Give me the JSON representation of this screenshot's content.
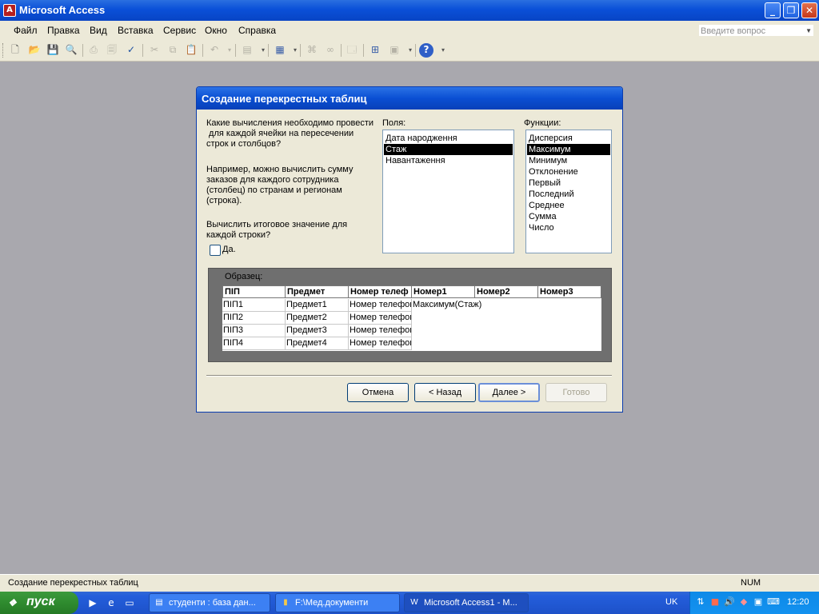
{
  "window": {
    "title": "Microsoft Access"
  },
  "menubar": {
    "items": [
      "Файл",
      "Правка",
      "Вид",
      "Вставка",
      "Сервис",
      "Окно",
      "Справка"
    ],
    "help_placeholder": "Введите вопрос"
  },
  "toolbar": {
    "icons": [
      "new-icon",
      "open-icon",
      "save-icon",
      "search-file-icon",
      "print-icon",
      "print-preview-icon",
      "spelling-icon",
      "cut-icon",
      "copy-icon",
      "paste-icon",
      "undo-icon",
      "office-links-icon",
      "analyze-icon",
      "code-icon",
      "script-icon",
      "properties-icon",
      "relationships-icon",
      "new-object-icon",
      "help-icon"
    ]
  },
  "dialog": {
    "title": "Создание перекрестных таблиц",
    "question_lines": [
      "Какие вычисления необходимо провести",
      " для каждой ячейки на пересечении",
      "строк и столбцов?"
    ],
    "example_lines": [
      "Например, можно вычислить сумму",
      "заказов для каждого сотрудника",
      "(столбец) по странам и регионам",
      "(строка)."
    ],
    "calc_lines": [
      "Вычислить итоговое значение для",
      "каждой строки?"
    ],
    "checkbox_label": "Да.",
    "checkbox_checked": false,
    "fields_label": "Поля:",
    "fields": [
      "Дата народження",
      "Стаж",
      "Навантаження"
    ],
    "fields_selected": "Стаж",
    "functions_label": "Функции:",
    "functions": [
      "Дисперсия",
      "Максимум",
      "Минимум",
      "Отклонение",
      "Первый",
      "Последний",
      "Среднее",
      "Сумма",
      "Число"
    ],
    "functions_selected": "Максимум",
    "sample_label": "Образец:",
    "sample": {
      "headers": [
        "ПІП",
        "Предмет",
        "Номер телеф",
        "Номер1",
        "Номер2",
        "Номер3"
      ],
      "rows": [
        [
          "ПІП1",
          "Предмет1",
          "Номер телефон",
          "Максимум(Стаж)"
        ],
        [
          "ПІП2",
          "Предмет2",
          "Номер телефон",
          ""
        ],
        [
          "ПІП3",
          "Предмет3",
          "Номер телефон",
          ""
        ],
        [
          "ПІП4",
          "Предмет4",
          "Номер телефон",
          ""
        ]
      ]
    },
    "buttons": {
      "cancel": "Отмена",
      "back": "< Назад",
      "next": "Далее >",
      "finish": "Готово"
    }
  },
  "statusbar": {
    "text": "Создание перекрестных таблиц",
    "num": "NUM"
  },
  "taskbar": {
    "start_label": "пуск",
    "tasks": [
      "студенти : база дан...",
      "F:\\Мед.документи",
      "Microsoft Access1 - М..."
    ],
    "lang": "UK",
    "clock": "12:20"
  }
}
